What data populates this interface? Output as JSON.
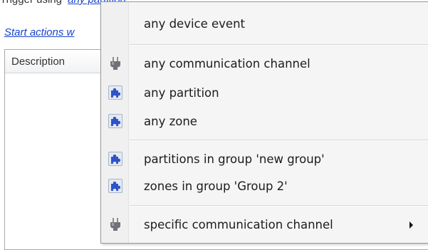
{
  "background": {
    "trigger_prefix": "Trigger using",
    "trigger_link": "any partition",
    "start_actions_link": "Start actions w",
    "grid": {
      "columns": [
        "Description"
      ]
    }
  },
  "menu": {
    "items": [
      {
        "label": "any device event",
        "icon": "none",
        "has_submenu": false
      },
      {
        "label": "any communication channel",
        "icon": "plug-icon",
        "has_submenu": false
      },
      {
        "label": "any partition",
        "icon": "puzzle-icon",
        "has_submenu": false
      },
      {
        "label": "any zone",
        "icon": "puzzle-icon",
        "has_submenu": false
      },
      {
        "label": "partitions in group 'new group'",
        "icon": "puzzle-icon",
        "has_submenu": false
      },
      {
        "label": "zones in group 'Group 2'",
        "icon": "puzzle-icon",
        "has_submenu": false
      },
      {
        "label": "specific communication channel",
        "icon": "plug-icon",
        "has_submenu": true
      }
    ]
  },
  "colors": {
    "link": "#1a44c9",
    "puzzle": "#2f54c8",
    "plug": "#6f7277"
  }
}
